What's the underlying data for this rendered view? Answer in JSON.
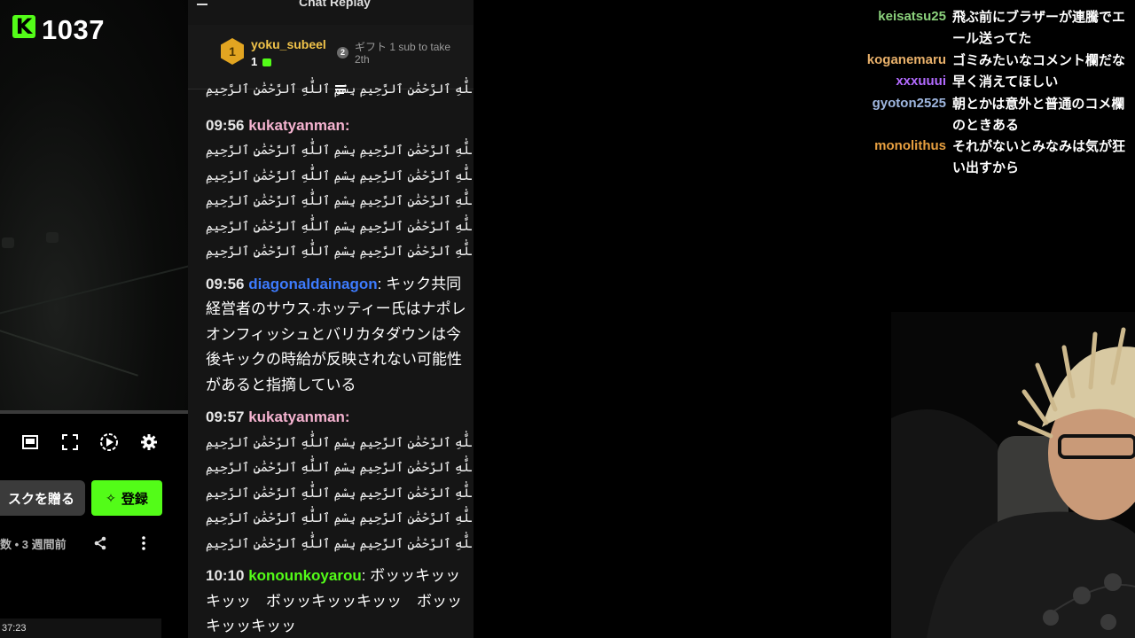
{
  "stream": {
    "viewer_count": "1037",
    "time_played": "37:23"
  },
  "player": {
    "gift_button": "スクを贈る",
    "subscribe_button": "登録",
    "meta": "数 • 3 週間前",
    "icons": [
      "theater-mode-icon",
      "fullscreen-icon",
      "clip-icon",
      "settings-icon"
    ]
  },
  "chat": {
    "title": "Chat Replay",
    "leaderboard": {
      "rank": "1",
      "user": "yoku_subeel",
      "count": "1",
      "next_rank": "2",
      "next_text": "ギフト 1 sub to take 2th"
    },
    "messages": [
      {
        "time": "",
        "user": "",
        "color": "#f2f2f2",
        "lines": [
          "بِسْمِ ٱللَّٰهِ ٱلرَّحْمَٰنِ ٱلرَّحِيمِ بِسْمِ ٱللَّٰهِ ٱلرَّحْمَٰنِ ٱلرَّحِيمِ"
        ],
        "text": ""
      },
      {
        "time": "09:56",
        "user": "kukatyanman:",
        "color": "#f5b3d0",
        "lines": [
          "بِسْمِ ٱللَّٰهِ ٱلرَّحْمَٰنِ ٱلرَّحِيمِ بِسْمِ ٱللَّٰهِ ٱلرَّحْمَٰنِ ٱلرَّحِيمِ",
          "بِسْمِ ٱللَّٰهِ ٱلرَّحْمَٰنِ ٱلرَّحِيمِ بِسْمِ ٱللَّٰهِ ٱلرَّحْمَٰنِ ٱلرَّحِيمِ",
          "بِسْمِ ٱللَّٰهِ ٱلرَّحْمَٰنِ ٱلرَّحِيمِ بِسْمِ ٱللَّٰهِ ٱلرَّحْمَٰنِ ٱلرَّحِيمِ",
          "بِسْمِ ٱللَّٰهِ ٱلرَّحْمَٰنِ ٱلرَّحِيمِ بِسْمِ ٱللَّٰهِ ٱلرَّحْمَٰنِ ٱلرَّحِيمِ",
          "بِسْمِ ٱللَّٰهِ ٱلرَّحْمَٰنِ ٱلرَّحِيمِ بِسْمِ ٱللَّٰهِ ٱلرَّحْمَٰنِ ٱلرَّحِيمِ"
        ],
        "text": ""
      },
      {
        "time": "09:56",
        "user": "diagonaldainagon",
        "color": "#3d7bfd",
        "lines": [],
        "text": ": キック共同経営者のサウス·ホッティー氏はナポレオンフィッシュとバリカタダウンは今後キックの時給が反映されない可能性があると指摘している"
      },
      {
        "time": "09:57",
        "user": "kukatyanman:",
        "color": "#f5b3d0",
        "lines": [
          "بِسْمِ ٱللَّٰهِ ٱلرَّحْمَٰنِ ٱلرَّحِيمِ بِسْمِ ٱللَّٰهِ ٱلرَّحْمَٰنِ ٱلرَّحِيمِ",
          "بِسْمِ ٱللَّٰهِ ٱلرَّحْمَٰنِ ٱلرَّحِيمِ بِسْمِ ٱللَّٰهِ ٱلرَّحْمَٰنِ ٱلرَّحِيمِ",
          "بِسْمِ ٱللَّٰهِ ٱلرَّحْمَٰنِ ٱلرَّحِيمِ بِسْمِ ٱللَّٰهِ ٱلرَّحْمَٰنِ ٱلرَّحِيمِ",
          "بِسْمِ ٱللَّٰهِ ٱلرَّحْمَٰنِ ٱلرَّحِيمِ بِسْمِ ٱللَّٰهِ ٱلرَّحْمَٰنِ ٱلرَّحِيمِ",
          "بِسْمِ ٱللَّٰهِ ٱلرَّحْمَٰنِ ٱلرَّحِيمِ بِسْمِ ٱللَّٰهِ ٱلرَّحْمَٰنِ ٱلرَّحِيمِ"
        ],
        "text": ""
      },
      {
        "time": "10:10",
        "user": "konounkoyarou",
        "color": "#53fc18",
        "lines": [],
        "text": ": ボッッキッッキッッ　ボッッキッッキッッ　ボッッキッッキッッ"
      }
    ]
  },
  "overlay": {
    "messages": [
      {
        "user": "keisatsu25",
        "color": "#8bd17c",
        "text": "飛ぶ前にブラザーが連騰でエール送ってた"
      },
      {
        "user": "koganemaru",
        "color": "#e8b06a",
        "text": "ゴミみたいなコメント欄だな"
      },
      {
        "user": "xxxuuui",
        "color": "#b36bff",
        "text": "早く消えてほしい"
      },
      {
        "user": "gyoton2525",
        "color": "#9fb7e0",
        "text": "朝とかは意外と普通のコメ欄のときある"
      },
      {
        "user": "monolithus",
        "color": "#e8a040",
        "text": "それがないとみなみは気が狂い出すから"
      }
    ]
  },
  "colors": {
    "kick_green": "#53fc18",
    "chat_bg": "#151515",
    "gold": "#e2a521"
  }
}
